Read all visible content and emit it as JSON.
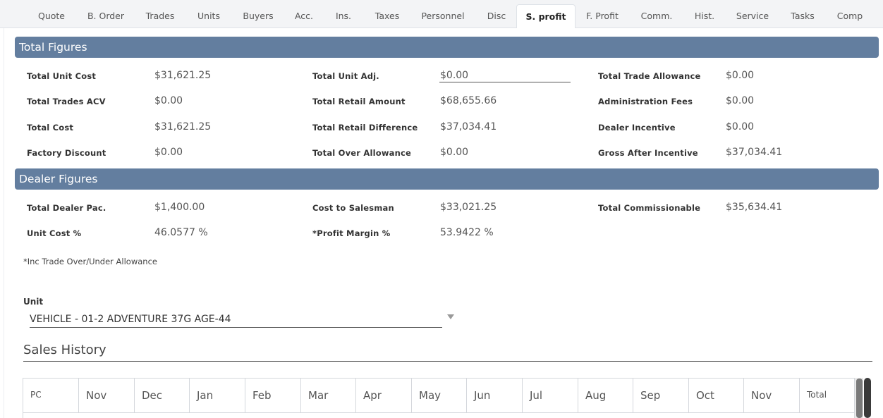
{
  "tabs": [
    {
      "label": "Quote"
    },
    {
      "label": "B. Order"
    },
    {
      "label": "Trades"
    },
    {
      "label": "Units"
    },
    {
      "label": "Buyers"
    },
    {
      "label": "Acc."
    },
    {
      "label": "Ins."
    },
    {
      "label": "Taxes"
    },
    {
      "label": "Personnel"
    },
    {
      "label": "Disc"
    },
    {
      "label": "S. profit",
      "active": true
    },
    {
      "label": "F. Profit"
    },
    {
      "label": "Comm."
    },
    {
      "label": "Hist."
    },
    {
      "label": "Service"
    },
    {
      "label": "Tasks"
    },
    {
      "label": "Comp"
    }
  ],
  "total_figures": {
    "title": "Total Figures",
    "total_unit_cost": {
      "label": "Total Unit Cost",
      "value": "$31,621.25"
    },
    "total_unit_adj": {
      "label": "Total Unit Adj.",
      "value": "$0.00"
    },
    "total_trade_allowance": {
      "label": "Total Trade Allowance",
      "value": "$0.00"
    },
    "total_trades_acv": {
      "label": "Total Trades ACV",
      "value": "$0.00"
    },
    "total_retail_amount": {
      "label": "Total Retail Amount",
      "value": "$68,655.66"
    },
    "administration_fees": {
      "label": "Administration Fees",
      "value": "$0.00"
    },
    "total_cost": {
      "label": "Total Cost",
      "value": "$31,621.25"
    },
    "total_retail_difference": {
      "label": "Total Retail Difference",
      "value": "$37,034.41"
    },
    "dealer_incentive": {
      "label": "Dealer Incentive",
      "value": "$0.00"
    },
    "factory_discount": {
      "label": "Factory Discount",
      "value": "$0.00"
    },
    "total_over_allowance": {
      "label": "Total Over Allowance",
      "value": "$0.00"
    },
    "gross_after_incentive": {
      "label": "Gross After Incentive",
      "value": "$37,034.41"
    }
  },
  "dealer_figures": {
    "title": "Dealer Figures",
    "total_dealer_pac": {
      "label": "Total Dealer Pac.",
      "value": "$1,400.00"
    },
    "cost_to_salesman": {
      "label": "Cost to Salesman",
      "value": "$33,021.25"
    },
    "total_commissionable": {
      "label": "Total Commissionable",
      "value": "$35,634.41"
    },
    "unit_cost_pct": {
      "label": "Unit Cost %",
      "value": "46.0577 %"
    },
    "profit_margin_pct": {
      "label": "*Profit Margin %",
      "value": "53.9422 %"
    }
  },
  "note": "*Inc Trade Over/Under Allowance",
  "unit": {
    "label": "Unit",
    "selected": "VEHICLE - 01-2 ADVENTURE 37G AGE-44"
  },
  "sales_history": {
    "title": "Sales History",
    "columns": [
      "PC",
      "Nov",
      "Dec",
      "Jan",
      "Feb",
      "Mar",
      "Apr",
      "May",
      "Jun",
      "Jul",
      "Aug",
      "Sep",
      "Oct",
      "Nov",
      "Total"
    ]
  }
}
